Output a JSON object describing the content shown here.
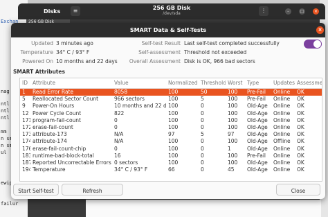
{
  "background": {
    "left_lines": [
      "Exchan",
      "",
      "",
      "",
      "",
      "",
      "",
      "",
      "",
      "nag",
      "",
      "ntl",
      "ntl",
      "ntl",
      "",
      "",
      "mm",
      "n sm",
      "n sm",
      "ul",
      "",
      "",
      "",
      "",
      "",
      "ewip",
      "",
      "",
      "",
      "",
      "",
      "failur"
    ],
    "left_link": "Exchan"
  },
  "disks_window": {
    "title": "Disks",
    "disk_title": "256 GB Disk",
    "disk_path": "/dev/sda",
    "menu_icon": "hamburger-icon",
    "selected_item": "256 GB Disk"
  },
  "dialog": {
    "title": "SMART Data & Self-Tests",
    "close_icon": "close-icon",
    "info_left": [
      {
        "label": "Updated",
        "value": "3 minutes ago"
      },
      {
        "label": "Temperature",
        "value": "34° C / 93° F"
      },
      {
        "label": "Powered On",
        "value": "10 months and 22 days"
      }
    ],
    "info_right": [
      {
        "label": "Self-test Result",
        "value": "Last self-test completed successfully"
      },
      {
        "label": "Self-assessment",
        "value": "Threshold not exceeded"
      },
      {
        "label": "Overall Assessment",
        "value": "Disk is OK, 966 bad sectors"
      }
    ],
    "smart_toggle_on": true,
    "attributes_title": "SMART Attributes",
    "columns": [
      "ID",
      "Attribute",
      "Value",
      "Normalized",
      "Threshold",
      "Worst",
      "Type",
      "Updates",
      "Assessment"
    ],
    "rows": [
      [
        "1",
        "Read Error Rate",
        "8058",
        "100",
        "50",
        "100",
        "Pre-Fail",
        "Online",
        "OK"
      ],
      [
        "5",
        "Reallocated Sector Count",
        "966 sectors",
        "100",
        "5",
        "100",
        "Pre-Fail",
        "Online",
        "OK"
      ],
      [
        "9",
        "Power-On Hours",
        "10 months and 22 days",
        "100",
        "0",
        "100",
        "Old-Age",
        "Online",
        "OK"
      ],
      [
        "12",
        "Power Cycle Count",
        "822",
        "100",
        "0",
        "100",
        "Old-Age",
        "Online",
        "OK"
      ],
      [
        "171",
        "program-fail-count",
        "0",
        "100",
        "0",
        "100",
        "Old-Age",
        "Online",
        "OK"
      ],
      [
        "172",
        "erase-fail-count",
        "0",
        "100",
        "0",
        "100",
        "Old-Age",
        "Online",
        "OK"
      ],
      [
        "173",
        "attribute-173",
        "N/A",
        "97",
        "5",
        "97",
        "Old-Age",
        "Online",
        "OK"
      ],
      [
        "174",
        "attribute-174",
        "N/A",
        "100",
        "0",
        "100",
        "Old-Age",
        "Offline",
        "OK"
      ],
      [
        "176",
        "erase-fail-count-chip",
        "0",
        "100",
        "0",
        "1",
        "Old-Age",
        "Online",
        "OK"
      ],
      [
        "183",
        "runtime-bad-block-total",
        "16",
        "100",
        "0",
        "100",
        "Pre-Fail",
        "Online",
        "OK"
      ],
      [
        "187",
        "Reported Uncorrectable Errors",
        "0 sectors",
        "100",
        "0",
        "100",
        "Old-Age",
        "Online",
        "OK"
      ],
      [
        "194",
        "Temperature",
        "34° C / 93° F",
        "66",
        "0",
        "45",
        "Old-Age",
        "Online",
        "OK"
      ]
    ],
    "selected_row": 0,
    "buttons": {
      "start": "Start Self-test",
      "refresh": "Refresh",
      "close": "Close"
    }
  },
  "colors": {
    "accent": "#e95420",
    "toggle": "#7b3f9e",
    "header": "#2c2c2c"
  }
}
